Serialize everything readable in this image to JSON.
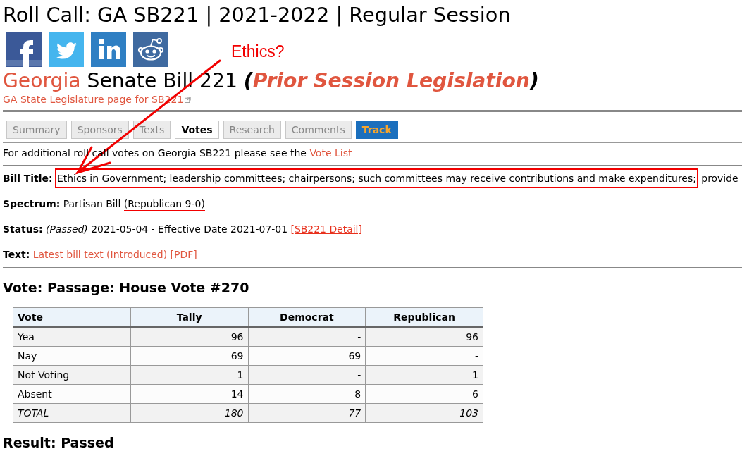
{
  "page_title": "Roll Call: GA SB221 | 2021-2022 | Regular Session",
  "bill_heading": {
    "state": "Georgia",
    "title": "Senate Bill 221",
    "note_open": "(",
    "note": "Prior Session Legislation",
    "note_close": ")"
  },
  "state_link": "GA State Legislature page for SB221",
  "callout": {
    "text": "Ethics?"
  },
  "tabs": [
    {
      "label": "Summary",
      "kind": "tab",
      "selected": false
    },
    {
      "label": "Sponsors",
      "kind": "tab",
      "selected": false
    },
    {
      "label": "Texts",
      "kind": "tab",
      "selected": false
    },
    {
      "label": "Votes",
      "kind": "tab",
      "selected": true
    },
    {
      "label": "Research",
      "kind": "tab",
      "selected": false
    },
    {
      "label": "Comments",
      "kind": "tab",
      "selected": false
    },
    {
      "label": "Track",
      "kind": "button",
      "selected": false
    }
  ],
  "vote_list_note": {
    "text": "For additional roll call votes on Georgia SB221 please see the",
    "link": "Vote List"
  },
  "fields": [
    {
      "label": "Bill Title:",
      "parts": [
        {
          "kind": "text",
          "text": "Ethics in Government; leadership committees; chairpersons; such committees may receive contributions and make expenditures;",
          "boxed": true
        },
        {
          "kind": "text",
          "text": "provide"
        }
      ]
    },
    {
      "label": "Spectrum:",
      "parts": [
        {
          "kind": "text",
          "text": "Partisan Bill"
        },
        {
          "kind": "text",
          "text": "(Republican 9-0)",
          "underlined": true
        }
      ]
    },
    {
      "label": "Status:",
      "parts": [
        {
          "kind": "text",
          "text": "*(Passed)* 2021-05-04 - Effective Date 2021-07-01"
        },
        {
          "kind": "link",
          "text": "[SB221 Detail]",
          "underlined": true
        }
      ]
    },
    {
      "label": "Text:",
      "parts": [
        {
          "kind": "link",
          "text": "Latest bill text (Introduced)"
        },
        {
          "kind": "link",
          "text": "[PDF]"
        }
      ]
    }
  ],
  "vote": {
    "heading": "Vote: Passage: House Vote #270",
    "table": {
      "columns": [
        "Vote",
        "Tally",
        "Democrat",
        "Republican"
      ],
      "rows": [
        {
          "kind": "count",
          "cells": [
            "Yea",
            "96",
            "-",
            "96"
          ]
        },
        {
          "kind": "count",
          "cells": [
            "Nay",
            "69",
            "69",
            "-"
          ]
        },
        {
          "kind": "count",
          "cells": [
            "Not Voting",
            "1",
            "-",
            "1"
          ]
        },
        {
          "kind": "count",
          "cells": [
            "Absent",
            "14",
            "8",
            "6"
          ]
        },
        {
          "kind": "total",
          "cells": [
            "TOTAL",
            "180",
            "77",
            "103"
          ]
        }
      ]
    },
    "result": "Result: Passed"
  }
}
